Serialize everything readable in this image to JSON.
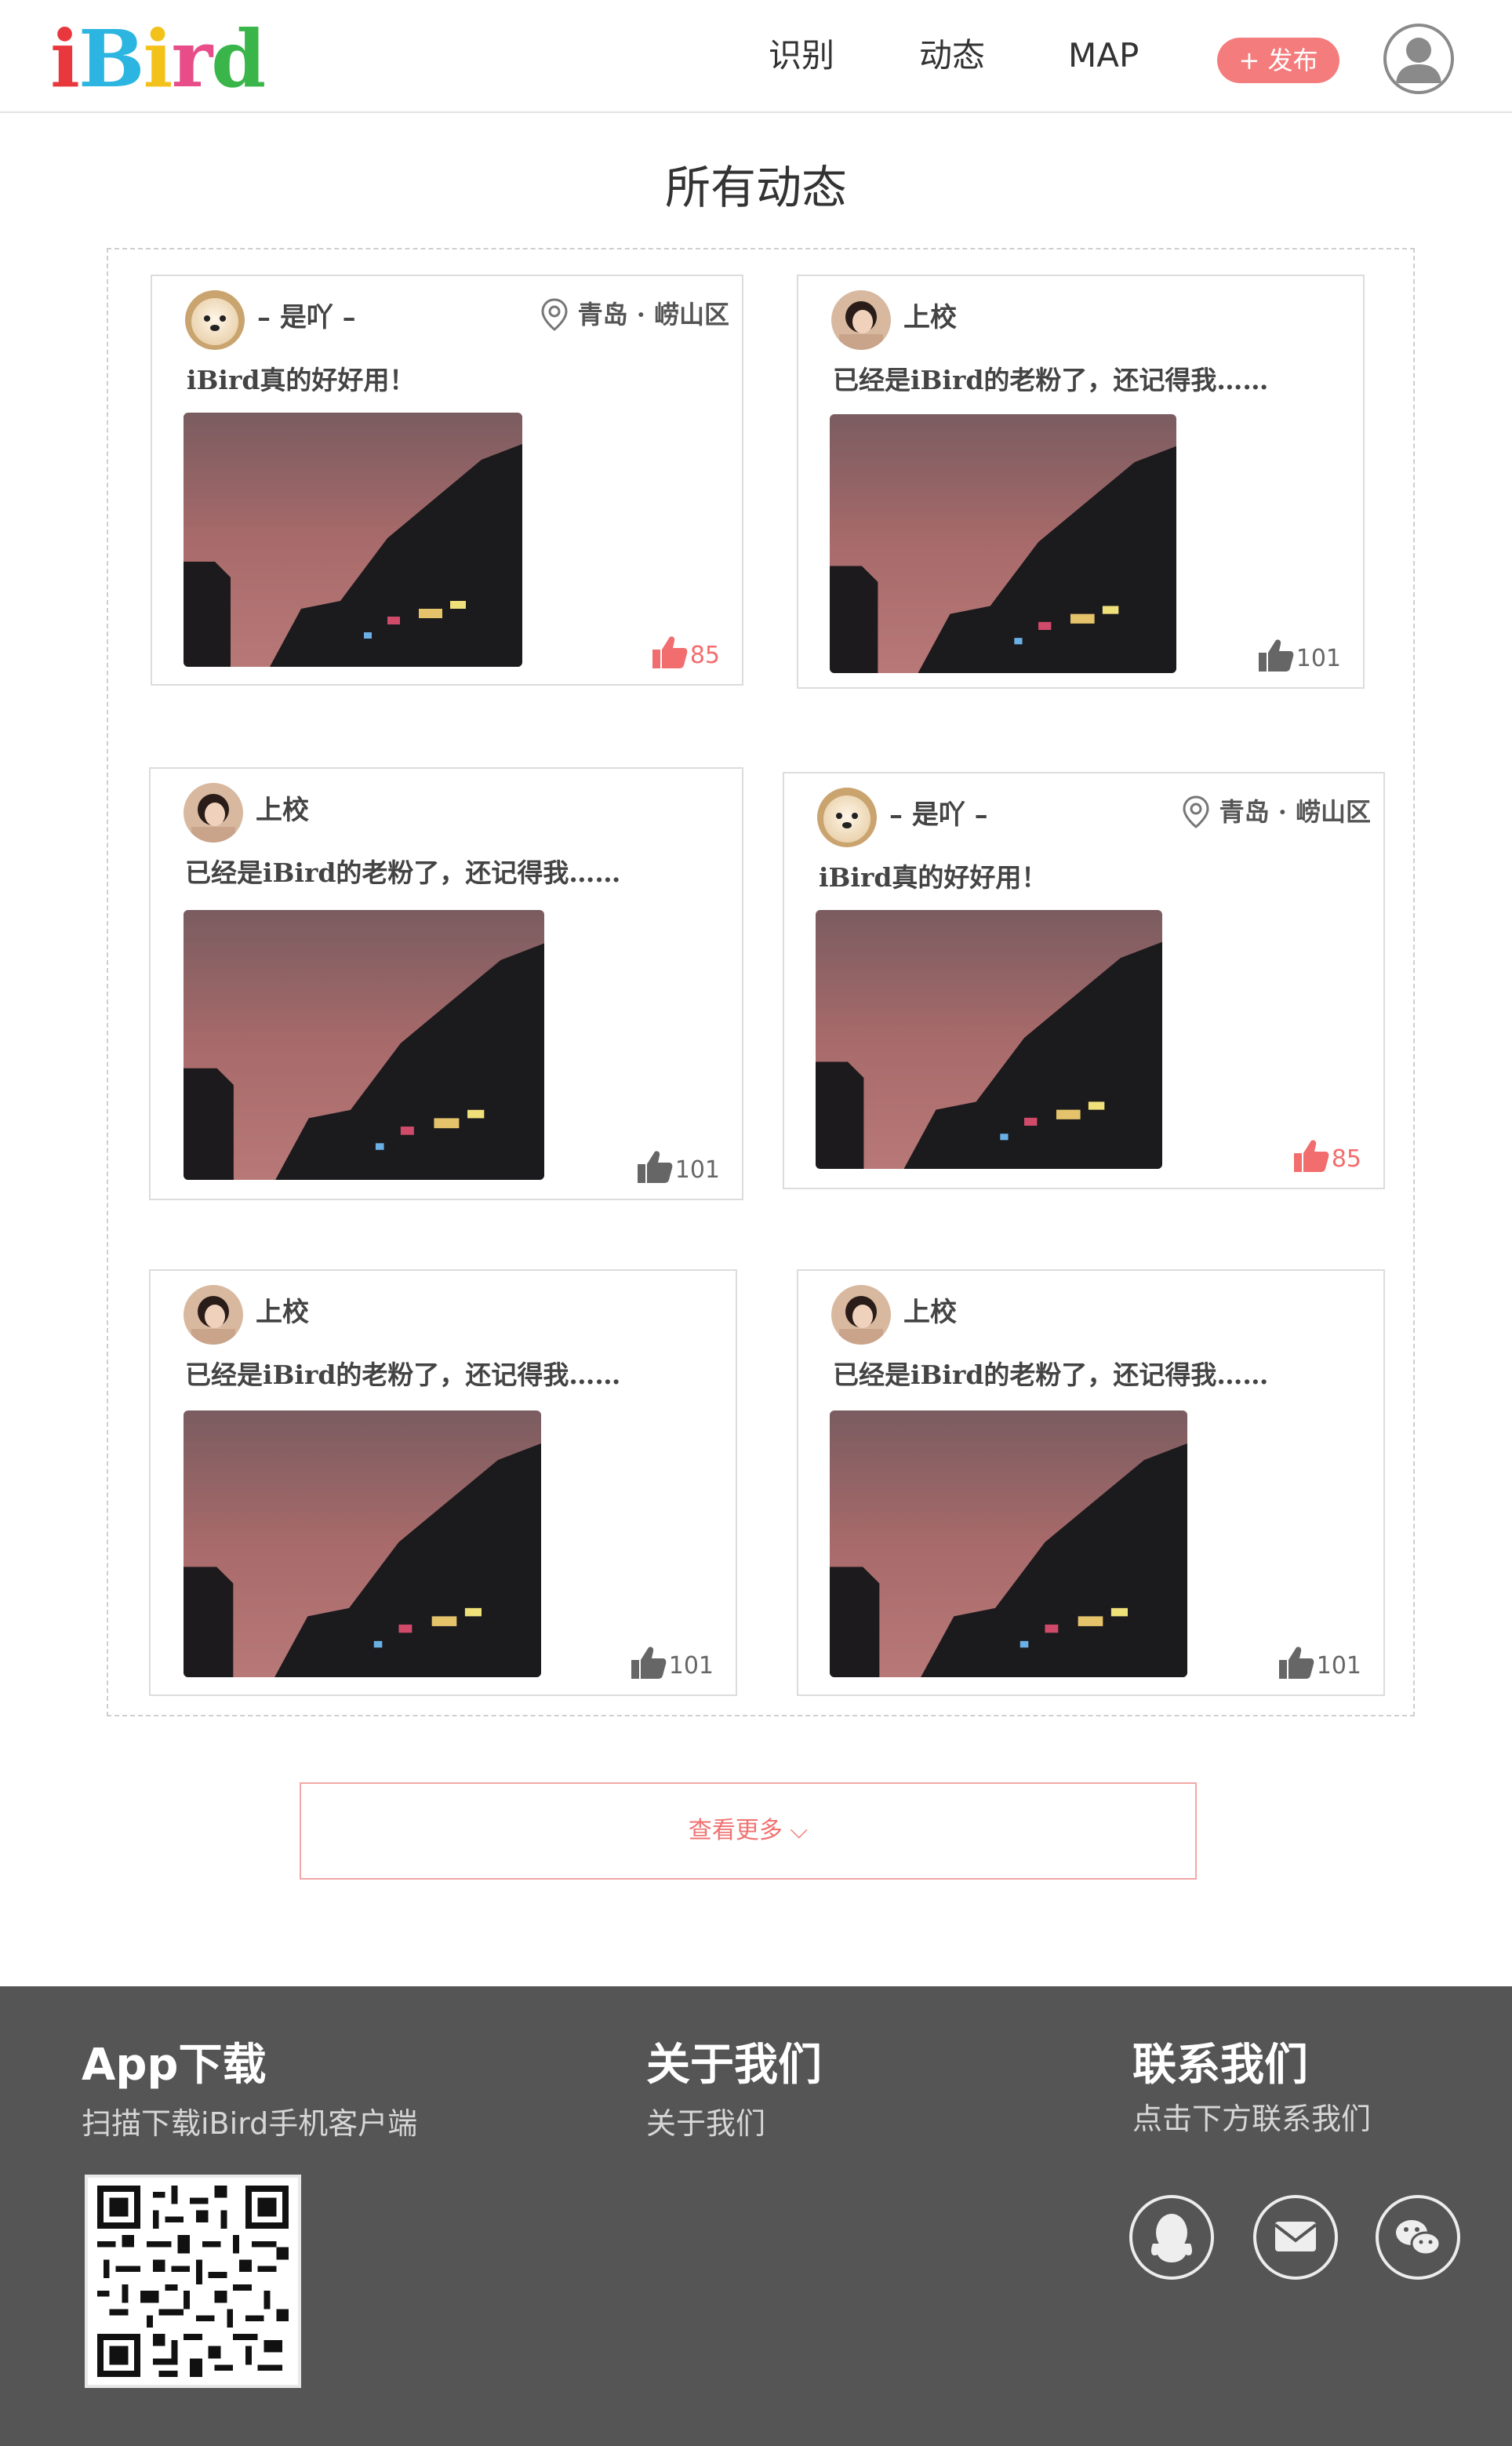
{
  "header": {
    "logo": [
      "i",
      "B",
      "i",
      "r",
      "d"
    ],
    "logo_colors": [
      "#e8383d",
      "#2bb5e0",
      "#f2c21b",
      "#e84d8a",
      "#39b54a"
    ],
    "nav": [
      "识别",
      "动态",
      "MAP"
    ],
    "publish": "+ 发布",
    "accent": "#f57c7c"
  },
  "page_title": "所有动态",
  "cards": [
    {
      "name": "– 是吖 –",
      "location": "青岛 · 崂山区",
      "text": "iBird真的好好用！",
      "likes": "85",
      "liked": true,
      "avatar": "dog"
    },
    {
      "name": "上校",
      "location": "",
      "text": "已经是iBird的老粉了，还记得我……",
      "likes": "101",
      "liked": false,
      "avatar": "girl"
    },
    {
      "name": "上校",
      "location": "",
      "text": "已经是iBird的老粉了，还记得我……",
      "likes": "101",
      "liked": false,
      "avatar": "girl"
    },
    {
      "name": "– 是吖 –",
      "location": "青岛 · 崂山区",
      "text": "iBird真的好好用！",
      "likes": "85",
      "liked": true,
      "avatar": "dog"
    },
    {
      "name": "上校",
      "location": "",
      "text": "已经是iBird的老粉了，还记得我……",
      "likes": "101",
      "liked": false,
      "avatar": "girl"
    },
    {
      "name": "上校",
      "location": "",
      "text": "已经是iBird的老粉了，还记得我……",
      "likes": "101",
      "liked": false,
      "avatar": "girl"
    }
  ],
  "more": "查看更多 ⌵",
  "footer": {
    "app_title": "App下载",
    "app_sub": "扫描下载iBird手机客户端",
    "about_title": "关于我们",
    "about_sub": "关于我们",
    "contact_title": "联系我们",
    "contact_sub": "点击下方联系我们",
    "socials": [
      "qq-icon",
      "mail-icon",
      "wechat-icon"
    ]
  }
}
